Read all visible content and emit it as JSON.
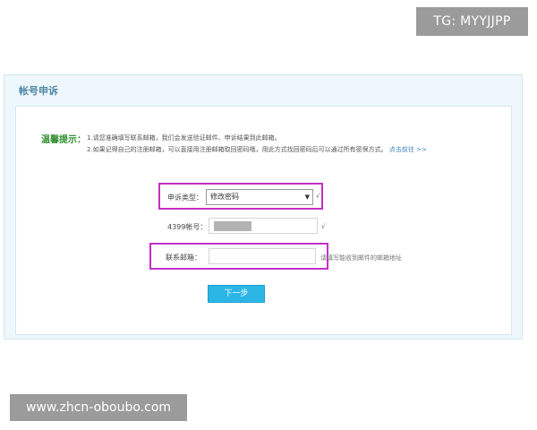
{
  "watermarks": {
    "tg": "TG: MYYJJPP",
    "site": "www.zhcn-oboubo.com"
  },
  "panel": {
    "title": "帐号申诉"
  },
  "tips": {
    "label": "温馨提示：",
    "line1": "1.请您准确填写联系邮箱，我们会发送验证邮件、申诉结果到此邮箱。",
    "line2": "2.如果记得自己的注册邮箱，可以直接用注册邮箱取回密码哦，用此方式找回密码后可以通过所有密保方式。",
    "link": "点击前往 >>"
  },
  "form": {
    "type_label": "申诉类型：",
    "type_value": "修改密码",
    "account_label": "4399帐号：",
    "email_label": "联系邮箱：",
    "email_hint": "请填写能收到邮件的邮箱地址",
    "check_mark": "√",
    "next_button": "下一步"
  },
  "colors": {
    "highlight": "#c32fc7",
    "button": "#2bb6e6",
    "tip_label": "#2f8f2f",
    "panel_title": "#4f86a8"
  }
}
